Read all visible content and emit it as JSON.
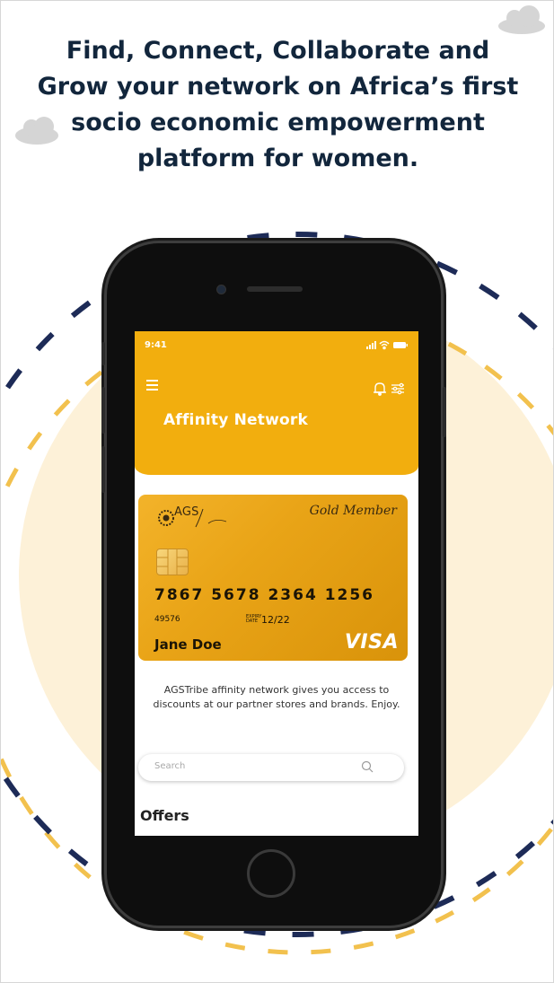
{
  "headline": "Find, Connect, Collaborate and Grow your network on Africa’s first socio economic empowerment platform for women.",
  "colors": {
    "accent": "#f2ae0e",
    "navy": "#1d2b57",
    "dash_yellow": "#f2c14e",
    "bg_circle": "#fcefd6",
    "cloud": "#d9d9d9"
  },
  "status_bar": {
    "time": "9:41",
    "icons": [
      "signal-icon",
      "wifi-icon",
      "battery-icon"
    ]
  },
  "app": {
    "title": "Affinity Network",
    "menu_icon": "hamburger-menu-icon",
    "header_icons": [
      "bell-icon",
      "filter-icon"
    ]
  },
  "card": {
    "brand": "AGSTribe",
    "logo_text": "AGS",
    "member_label": "Gold Member",
    "number": "7867 5678 2364 1256",
    "code": "49576",
    "expiry_label_1": "EXPIRY",
    "expiry_label_2": "DATE",
    "expiry": "12/22",
    "holder": "Jane Doe",
    "network": "VISA"
  },
  "description": "AGSTribe affinity network gives you access to discounts at our partner stores and brands. Enjoy.",
  "search": {
    "placeholder": "Search"
  },
  "offers_title": "Offers"
}
